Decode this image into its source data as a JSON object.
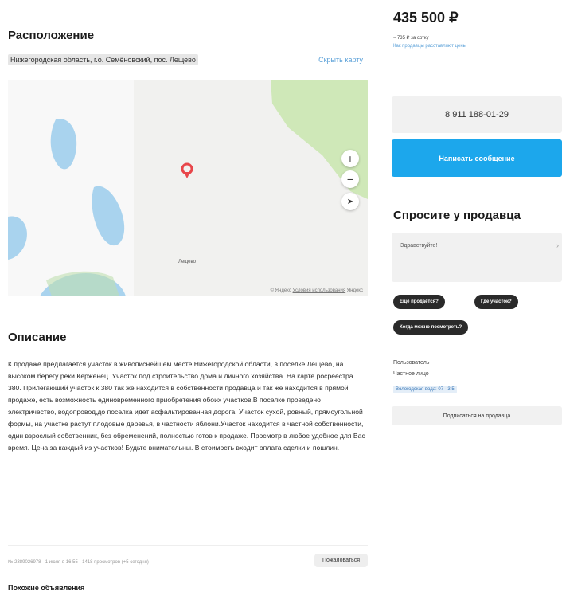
{
  "location": {
    "title": "Расположение",
    "address": "Нижегородская область, г.о. Семёновский, пос. Лещево",
    "hide_map": "Скрыть карту"
  },
  "map": {
    "zoom_in": "+",
    "zoom_out": "−",
    "footer_prefix": "© Яндекс",
    "footer_link": "Условия использования",
    "footer_brand": "Яндекс",
    "pin_label": "Лещево"
  },
  "description": {
    "title": "Описание",
    "text": "К продаже предлагается участок в живописнейшем месте Нижегородской области, в поселке Лещево, на высоком берегу реки Керженец. Участок под строительство дома и личного хозяйства. На карте росреестра 380. Прилегающий участок к 380 так же находится в собственности продавца и так же находится в прямой продаже, есть возможность единовременного приобретения обоих участков.В поселке проведено электричество, водопровод,до поселка идет асфальтированная дорога. Участок сухой, ровный, прямоугольной формы, на участке растут плодовые деревья, в частности яблони.Участок находится в частной собственности, один взрослый собственник, без обременений, полностью готов к продаже. Просмотр в любое удобное для Вас время. Цена за каждый из участков! Будьте внимательны. В стоимость входит оплата сделки и пошлин."
  },
  "meta": {
    "text": "№ 2389026978 · 1 июля в 16:55 · 1418 просмотров (+5 сегодня)",
    "complain": "Пожаловаться"
  },
  "similar_title": "Похожие объявления",
  "sidebar": {
    "price": "435 500 ₽",
    "price_sub": "≈ 735 ₽ за сотку",
    "price_link": "Как продавцы расставляют цены",
    "phone": "8 911 188-01-29",
    "write_button": "Написать сообщение",
    "ask_title": "Спросите у продавца",
    "ask_placeholder": "Здравствуйте!",
    "ask_arrow": "›",
    "chips": [
      "Ещё продаётся?",
      "Где участок?",
      "Когда можно посмотреть?"
    ],
    "seller": {
      "line1": "Пользователь",
      "line2": "Частное лицо",
      "badge": "Вологодская вода: 07 · 3.5",
      "subscribe": "Подписаться на продавца"
    }
  },
  "colors": {
    "accent_blue": "#1ca7ec",
    "link_blue": "#5aa0d8",
    "water": "#a9d3ee",
    "forest": "#cfe8b8",
    "pin": "#e8464a"
  }
}
